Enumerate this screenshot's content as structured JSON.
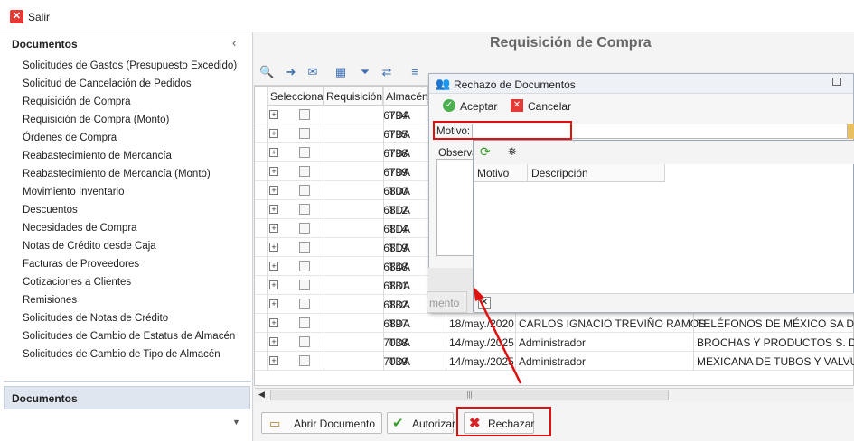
{
  "topbar": {
    "exit_label": "Salir"
  },
  "sidebar": {
    "header": "Documentos",
    "items": [
      "Solicitudes de Gastos (Presupuesto Excedido)",
      "Solicitud de Cancelación de Pedidos",
      "Requisición de Compra",
      "Requisición de Compra (Monto)",
      "Órdenes de Compra",
      "Reabastecimiento de Mercancía",
      "Reabastecimiento de Mercancía (Monto)",
      "Movimiento Inventario",
      "Descuentos",
      "Necesidades de Compra",
      "Notas de Crédito desde Caja",
      "Facturas de Proveedores",
      "Cotizaciones a Clientes",
      "Remisiones",
      "Solicitudes de Notas de Crédito",
      "Solicitudes de Cambio de Estatus de Almacén",
      "Solicitudes de Cambio de Tipo de Almacén"
    ],
    "footer": "Documentos"
  },
  "main": {
    "title": "Requisición de Compra",
    "columns": [
      "Seleccionar",
      "Requisición",
      "Almacén"
    ],
    "rows": [
      {
        "req": "6794",
        "alm": "TDA",
        "fecha": "",
        "usuario": "",
        "proveedor": ""
      },
      {
        "req": "6795",
        "alm": "TDA",
        "fecha": "",
        "usuario": "",
        "proveedor": ""
      },
      {
        "req": "6798",
        "alm": "TDA",
        "fecha": "",
        "usuario": "",
        "proveedor": ""
      },
      {
        "req": "6799",
        "alm": "TDA",
        "fecha": "",
        "usuario": "",
        "proveedor": ""
      },
      {
        "req": "6800",
        "alm": "TDA",
        "fecha": "",
        "usuario": "",
        "proveedor": ""
      },
      {
        "req": "6812",
        "alm": "TDA",
        "fecha": "",
        "usuario": "",
        "proveedor": ""
      },
      {
        "req": "6814",
        "alm": "TDA",
        "fecha": "",
        "usuario": "",
        "proveedor": ""
      },
      {
        "req": "6819",
        "alm": "TDA",
        "fecha": "",
        "usuario": "",
        "proveedor": ""
      },
      {
        "req": "6848",
        "alm": "TDA",
        "fecha": "",
        "usuario": "",
        "proveedor": ""
      },
      {
        "req": "6881",
        "alm": "TDA",
        "fecha": "",
        "usuario": "",
        "proveedor": ""
      },
      {
        "req": "6882",
        "alm": "TDA",
        "fecha": "",
        "usuario": "",
        "proveedor": ""
      },
      {
        "req": "6897",
        "alm": "TDA",
        "fecha": "18/may./2020",
        "usuario": "CARLOS IGNACIO TREVIÑO RAMOS",
        "proveedor": "TELÉFONOS DE MÉXICO SA DE CV"
      },
      {
        "req": "7038",
        "alm": "TDA",
        "fecha": "14/may./2025",
        "usuario": "Administrador",
        "proveedor": "BROCHAS Y PRODUCTOS S. DE R.L."
      },
      {
        "req": "7039",
        "alm": "TDA",
        "fecha": "14/may./2025",
        "usuario": "Administrador",
        "proveedor": "MEXICANA DE TUBOS Y VALVULAS  S"
      }
    ],
    "buttons": {
      "open": "Abrir Documento",
      "authorize": "Autorizar",
      "reject": "Rechazar"
    },
    "hidden_btn_text": "mento"
  },
  "dialog": {
    "title": "Rechazo de Documentos",
    "accept": "Aceptar",
    "cancel": "Cancelar",
    "motivo_label": "Motivo:",
    "motivo_value": "",
    "obs_label": "Observa",
    "popup_columns": [
      "Motivo",
      "Descripción"
    ]
  },
  "colors": {
    "highlight": "#e01010",
    "accent": "#3d6fb0"
  }
}
